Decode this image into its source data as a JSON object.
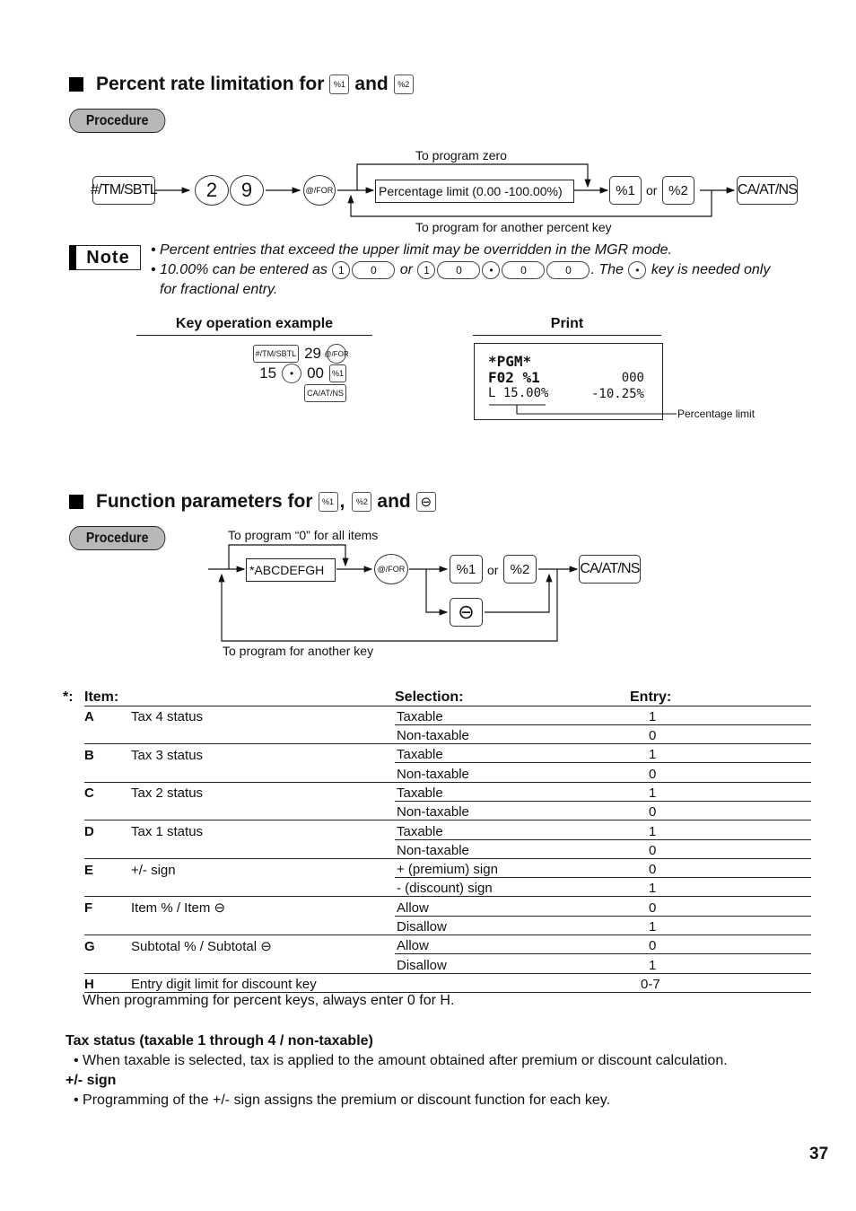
{
  "section1": {
    "title_prefix": "Percent rate limitation for",
    "title_key1": "%1",
    "title_and": "and",
    "title_key2": "%2",
    "procedure_label": "Procedure",
    "flow": {
      "key_sbtl": "#/TM/SBTL",
      "digit1": "2",
      "digit2": "9",
      "key_for": "@/FOR",
      "box_limit": "Percentage limit (0.00 -100.00%)",
      "key_pct1": "%1",
      "or": "or",
      "key_pct2": "%2",
      "key_caat": "CA/AT/NS",
      "label_zero": "To program zero",
      "label_another": "To program for another percent key"
    },
    "note": {
      "badge": "Note",
      "line1": "• Percent entries that exceed the upper limit may be overridden in the MGR mode.",
      "line2_prefix": "• 10.00% can be entered as",
      "line2_keys_a": [
        "1",
        "0"
      ],
      "line2_or": "or",
      "line2_keys_b": [
        "1",
        "0",
        "•",
        "0",
        "0"
      ],
      "line2_the": ". The",
      "line2_dot": "•",
      "line2_suffix": "key is needed only",
      "line3": "for fractional entry."
    },
    "example": {
      "heading": "Key operation example",
      "row1": {
        "key": "#/TM/SBTL",
        "num": "29",
        "key2": "@/FOR"
      },
      "row2": {
        "num1": "15",
        "dot": "•",
        "num2": "00",
        "key": "%1"
      },
      "row3": {
        "key": "CA/AT/NS"
      }
    },
    "print": {
      "heading": "Print",
      "line1": "*PGM*",
      "line2_left": "F02 %1",
      "line2_right": "000",
      "line3_left": "L 15.00%",
      "line3_right": "-10.25%",
      "callout": "Percentage limit"
    }
  },
  "section2": {
    "title_prefix": "Function parameters for",
    "title_key1": "%1",
    "title_comma": ",",
    "title_key2": "%2",
    "title_and": "and",
    "title_key3": "⊖",
    "procedure_label": "Procedure",
    "flow": {
      "label_zero": "To program “0” for all items",
      "box_abc": "*ABCDEFGH",
      "key_for": "@/FOR",
      "key_pct1": "%1",
      "or": "or",
      "key_pct2": "%2",
      "key_minus": "⊖",
      "key_caat": "CA/AT/NS",
      "label_another": "To program for another key"
    },
    "table": {
      "col_star": "*:",
      "col_item": "Item:",
      "col_selection": "Selection:",
      "col_entry": "Entry:",
      "groups": [
        {
          "letter": "A",
          "item": "Tax 4 status",
          "rows": [
            {
              "sel": "Taxable",
              "entry": "1"
            },
            {
              "sel": "Non-taxable",
              "entry": "0"
            }
          ]
        },
        {
          "letter": "B",
          "item": "Tax 3 status",
          "rows": [
            {
              "sel": "Taxable",
              "entry": "1"
            },
            {
              "sel": "Non-taxable",
              "entry": "0"
            }
          ]
        },
        {
          "letter": "C",
          "item": "Tax 2 status",
          "rows": [
            {
              "sel": "Taxable",
              "entry": "1"
            },
            {
              "sel": "Non-taxable",
              "entry": "0"
            }
          ]
        },
        {
          "letter": "D",
          "item": "Tax 1 status",
          "rows": [
            {
              "sel": "Taxable",
              "entry": "1"
            },
            {
              "sel": "Non-taxable",
              "entry": "0"
            }
          ]
        },
        {
          "letter": "E",
          "item": "+/- sign",
          "rows": [
            {
              "sel": "+ (premium) sign",
              "entry": "0"
            },
            {
              "sel": "- (discount) sign",
              "entry": "1"
            }
          ]
        },
        {
          "letter": "F",
          "item": "Item % / Item ⊖",
          "rows": [
            {
              "sel": "Allow",
              "entry": "0"
            },
            {
              "sel": "Disallow",
              "entry": "1"
            }
          ]
        },
        {
          "letter": "G",
          "item": "Subtotal % / Subtotal ⊖",
          "rows": [
            {
              "sel": "Allow",
              "entry": "0"
            },
            {
              "sel": "Disallow",
              "entry": "1"
            }
          ]
        },
        {
          "letter": "H",
          "item": "Entry digit limit for discount key",
          "rows": [
            {
              "sel": "",
              "entry": "0-7"
            }
          ]
        }
      ],
      "footnote": "When programming for percent keys, always enter 0 for H."
    },
    "notes": {
      "tax_heading": "Tax status (taxable 1 through 4 / non-taxable)",
      "tax_text": "• When taxable is selected, tax is applied to the amount obtained after premium or discount calculation.",
      "sign_heading": "+/- sign",
      "sign_text": "• Programming of the +/- sign assigns the premium or discount function for each key."
    }
  },
  "page_number": "37"
}
